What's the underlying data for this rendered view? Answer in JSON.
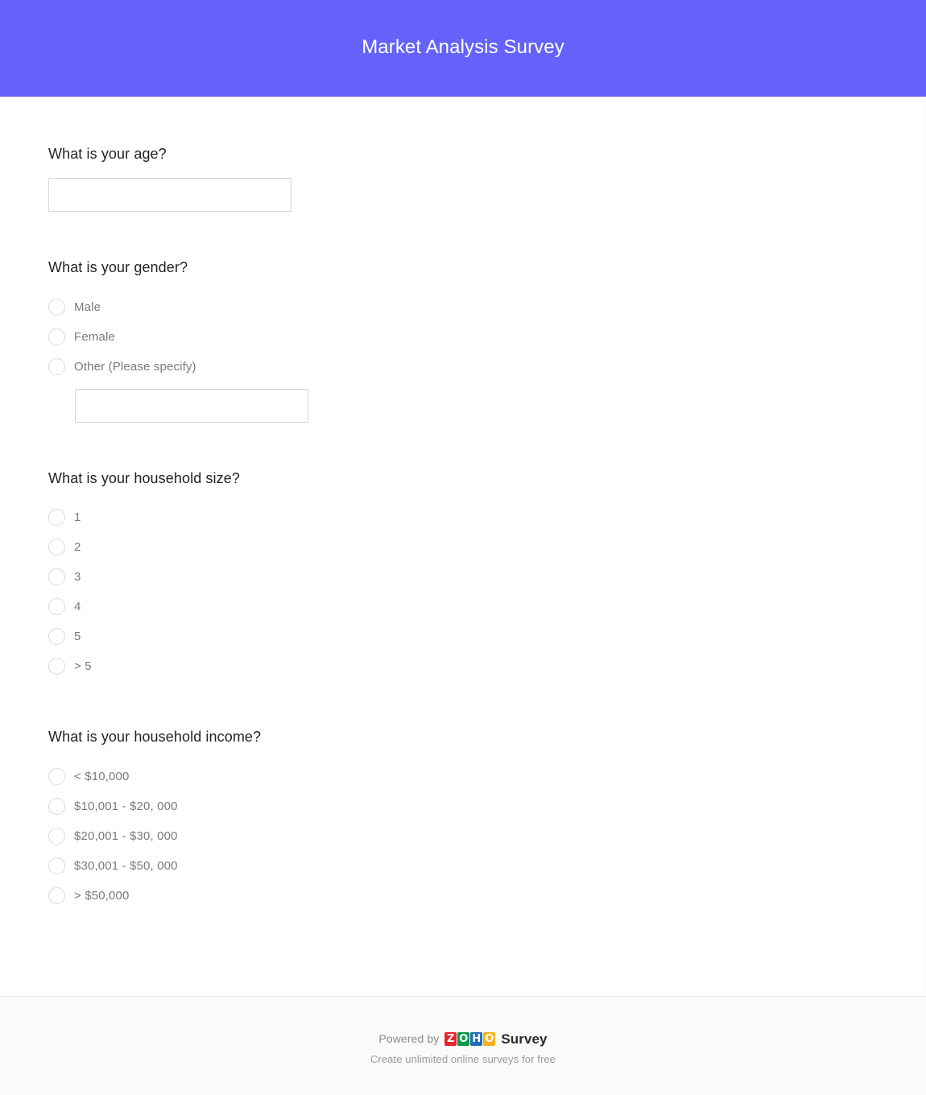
{
  "header": {
    "title": "Market Analysis Survey",
    "background_color": "#6462fb",
    "text_color": "#ffffff"
  },
  "questions": [
    {
      "id": "age",
      "title": "What is your age?",
      "type": "text",
      "value": "",
      "placeholder": ""
    },
    {
      "id": "gender",
      "title": "What is your gender?",
      "type": "radio",
      "options": [
        {
          "label": "Male",
          "selected": false
        },
        {
          "label": "Female",
          "selected": false
        },
        {
          "label": "Other (Please specify)",
          "selected": false
        }
      ],
      "other_input": {
        "value": "",
        "placeholder": ""
      }
    },
    {
      "id": "household_size",
      "title": "What is your household size?",
      "type": "radio",
      "options": [
        {
          "label": "1",
          "selected": false
        },
        {
          "label": "2",
          "selected": false
        },
        {
          "label": "3",
          "selected": false
        },
        {
          "label": "4",
          "selected": false
        },
        {
          "label": "5",
          "selected": false
        },
        {
          "label": "> 5",
          "selected": false
        }
      ]
    },
    {
      "id": "household_income",
      "title": "What is your household income?",
      "type": "radio",
      "options": [
        {
          "label": "< $10,000",
          "selected": false
        },
        {
          "label": "$10,001 - $20, 000",
          "selected": false
        },
        {
          "label": "$20,001 - $30, 000",
          "selected": false
        },
        {
          "label": "$30,001 - $50, 000",
          "selected": false
        },
        {
          "label": "> $50,000",
          "selected": false
        }
      ]
    }
  ],
  "footer": {
    "powered_by": "Powered by",
    "brand_letters": [
      {
        "char": "Z",
        "color": "#e42527"
      },
      {
        "char": "O",
        "color": "#089949"
      },
      {
        "char": "H",
        "color": "#226db4"
      },
      {
        "char": "O",
        "color": "#f9b21d"
      }
    ],
    "product_word": "Survey",
    "tagline": "Create unlimited online surveys for free"
  }
}
